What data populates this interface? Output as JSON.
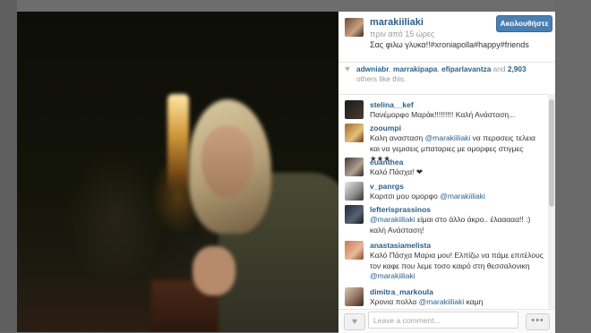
{
  "post": {
    "username": "marakiiliaki",
    "time_ago": "πριν από 15 ώρες",
    "caption": "Σας φιλω γλυκα!!#xroniapolla#happy#friends",
    "follow_label": "Ακολουθήστε"
  },
  "likes": {
    "heart_icon": "heart-icon",
    "users": [
      "adwniabr",
      "marrakipapa",
      "efiparlavantza"
    ],
    "sep1": ", ",
    "sep2": ", ",
    "and_text": " and ",
    "count": "2,903",
    "suffix": " others like this."
  },
  "comments": [
    {
      "user": "stelina__kef",
      "text": "Πανέμορφο Μαράκ!!!!!!!!! Καλή Ανάσταση..."
    },
    {
      "user": "zooumpi",
      "text": "Καλη ανασταση ",
      "mention": "@marakiiliaki",
      "text2": " να περασεις τελεια και να γεμισεις μπαταριες με ομορφες στιγμες ★★★"
    },
    {
      "user": "euanthea",
      "text": "Καλό Πάσχα! ❤"
    },
    {
      "user": "v_panrgs",
      "text": "Κοριτσι μου ομορφο ",
      "mention": "@marakiiliaki",
      "text2": ""
    },
    {
      "user": "lefterisprassinos",
      "text": "",
      "mention": "@marakiiliaki",
      "text2": " είμαι στο άλλο άκρο.. έλααααα!! :) καλή Ανάσταση!"
    },
    {
      "user": "anastasiamelista",
      "text": "Καλό Πάσχα Μαρια μου! Ελπίζω να πάμε επιτέλους τον καφε που λεμε τοσο καιρό στη θεσσαλονικη ",
      "mention": "@marakiiliaki",
      "text2": ""
    },
    {
      "user": "dimitra_markoula",
      "text": "Χρονια πολλα ",
      "mention": "@marakiiliaki",
      "text2": " καμη"
    }
  ],
  "footer": {
    "like_icon": "heart-icon",
    "comment_placeholder": "Leave a comment...",
    "more_label": "•••"
  }
}
